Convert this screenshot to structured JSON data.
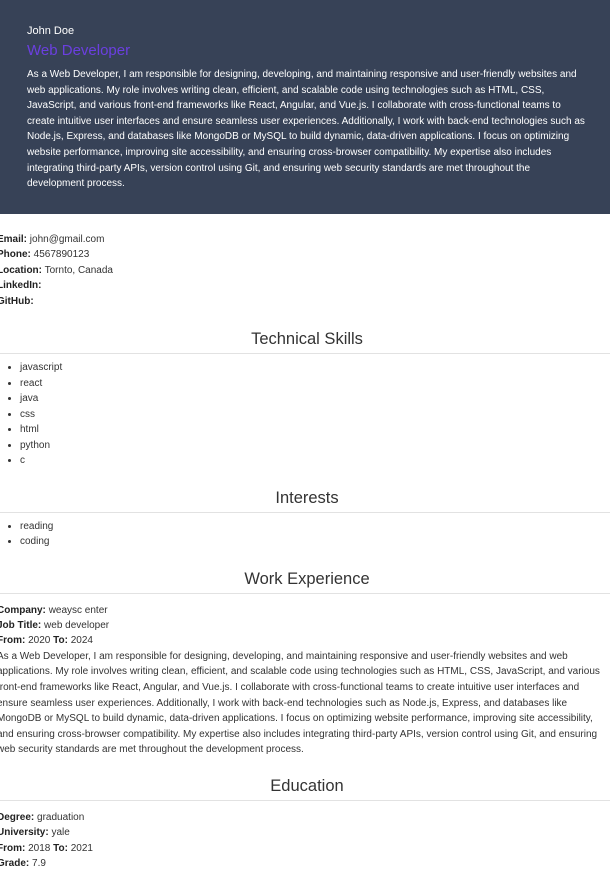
{
  "header": {
    "name": "John Doe",
    "role": "Web Developer",
    "summary": "As a Web Developer, I am responsible for designing, developing, and maintaining responsive and user-friendly websites and web applications. My role involves writing clean, efficient, and scalable code using technologies such as HTML, CSS, JavaScript, and various front-end frameworks like React, Angular, and Vue.js. I collaborate with cross-functional teams to create intuitive user interfaces and ensure seamless user experiences. Additionally, I work with back-end technologies such as Node.js, Express, and databases like MongoDB or MySQL to build dynamic, data-driven applications. I focus on optimizing website performance, improving site accessibility, and ensuring cross-browser compatibility. My expertise also includes integrating third-party APIs, version control using Git, and ensuring web security standards are met throughout the development process."
  },
  "contact": {
    "email_label": "Email:",
    "email": "john@gmail.com",
    "phone_label": "Phone:",
    "phone": "4567890123",
    "location_label": "Location:",
    "location": "Tornto, Canada",
    "linkedin_label": "LinkedIn:",
    "github_label": "GitHub:"
  },
  "skills": {
    "title": "Technical Skills",
    "items": [
      "javascript",
      "react",
      "java",
      "css",
      "html",
      "python",
      "c"
    ]
  },
  "interests": {
    "title": "Interests",
    "items": [
      "reading",
      "coding"
    ]
  },
  "experience": {
    "title": "Work Experience",
    "company_label": "Company:",
    "company": "weaysc enter",
    "job_title_label": "Job Title:",
    "job_title": "web developer",
    "from_label": "From:",
    "from": "2020",
    "to_label": "To:",
    "to": "2024",
    "description": "As a Web Developer, I am responsible for designing, developing, and maintaining responsive and user-friendly websites and web applications. My role involves writing clean, efficient, and scalable code using technologies such as HTML, CSS, JavaScript, and various front-end frameworks like React, Angular, and Vue.js. I collaborate with cross-functional teams to create intuitive user interfaces and ensure seamless user experiences. Additionally, I work with back-end technologies such as Node.js, Express, and databases like MongoDB or MySQL to build dynamic, data-driven applications. I focus on optimizing website performance, improving site accessibility, and ensuring cross-browser compatibility. My expertise also includes integrating third-party APIs, version control using Git, and ensuring web security standards are met throughout the development process."
  },
  "education": {
    "title": "Education",
    "degree_label": "Degree:",
    "degree": "graduation",
    "university_label": "University:",
    "university": "yale",
    "from_label": "From:",
    "from": "2018",
    "to_label": "To:",
    "to": "2021",
    "grade_label": "Grade:",
    "grade": "7.9"
  }
}
